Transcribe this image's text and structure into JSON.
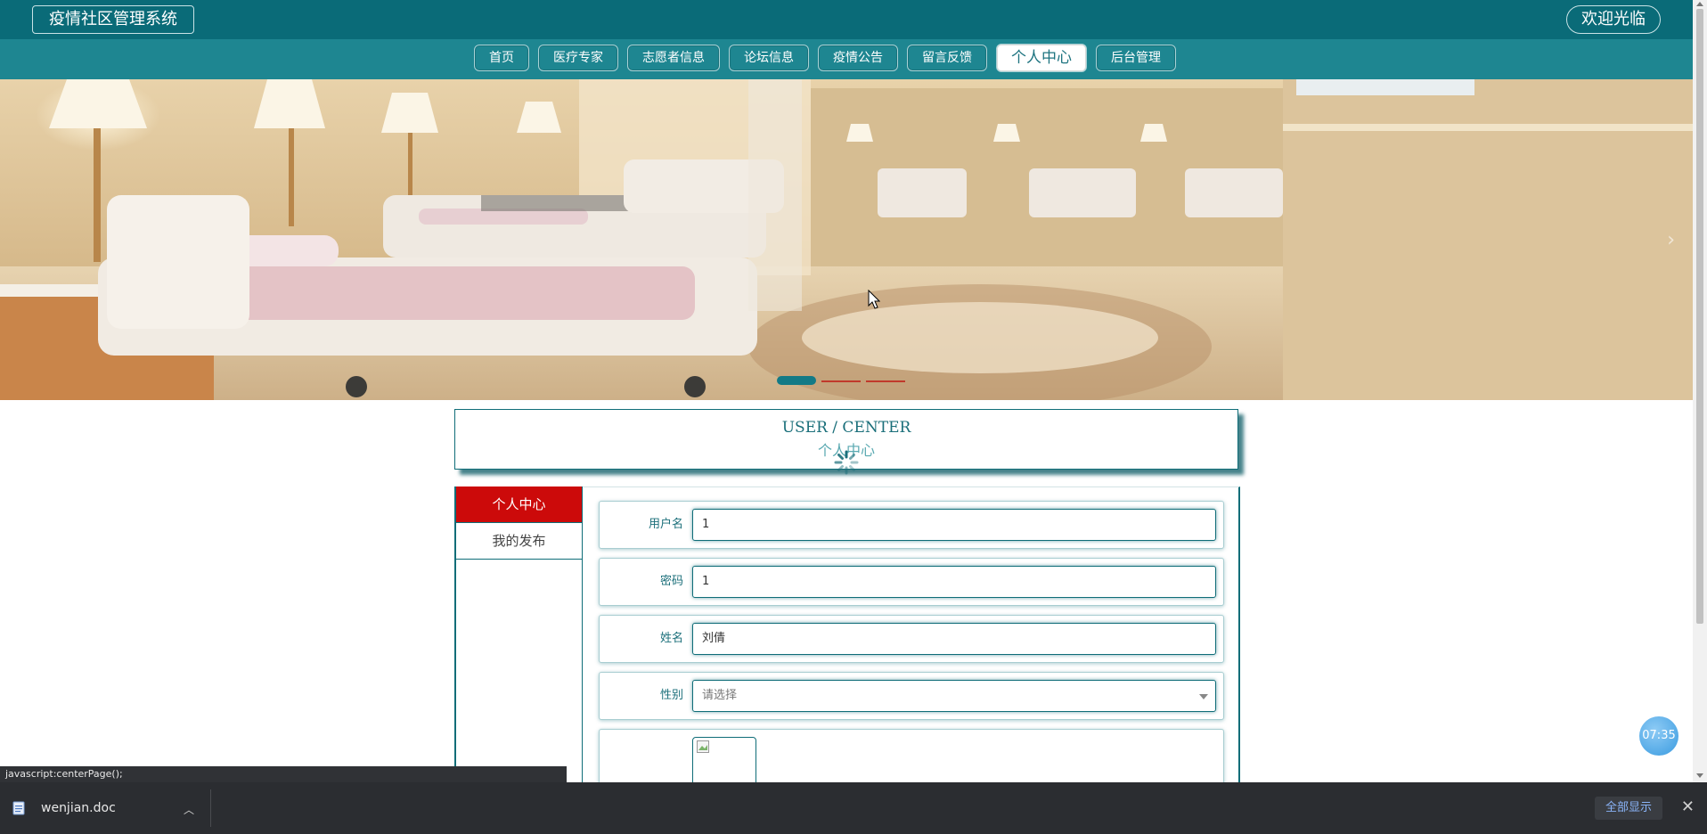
{
  "header": {
    "site_title": "疫情社区管理系统",
    "welcome": "欢迎光临"
  },
  "nav": {
    "items": [
      {
        "label": "首页"
      },
      {
        "label": "医疗专家"
      },
      {
        "label": "志愿者信息"
      },
      {
        "label": "论坛信息"
      },
      {
        "label": "疫情公告"
      },
      {
        "label": "留言反馈"
      },
      {
        "label": "个人中心",
        "active": true
      },
      {
        "label": "后台管理"
      }
    ]
  },
  "banner": {
    "slide_count": 3,
    "active_slide": 1
  },
  "user_center": {
    "title_en": "USER / CENTER",
    "title_cn": "个人中心"
  },
  "sidebar": {
    "items": [
      {
        "label": "个人中心",
        "active": true
      },
      {
        "label": "我的发布"
      }
    ]
  },
  "form": {
    "username": {
      "label": "用户名",
      "value": "1"
    },
    "password": {
      "label": "密码",
      "value": "1"
    },
    "name": {
      "label": "姓名",
      "value": "刘倩"
    },
    "gender": {
      "label": "性别",
      "placeholder": "请选择"
    }
  },
  "clock": {
    "time": "07:35"
  },
  "status_bar": {
    "url": "javascript:centerPage();"
  },
  "download_bar": {
    "file_name": "wenjian.doc",
    "show_all": "全部显示"
  },
  "colors": {
    "topbar": "#0a6b78",
    "navbar": "#1e8691",
    "sidebar_active": "#cc0a0a",
    "accent": "#0f6d78"
  }
}
